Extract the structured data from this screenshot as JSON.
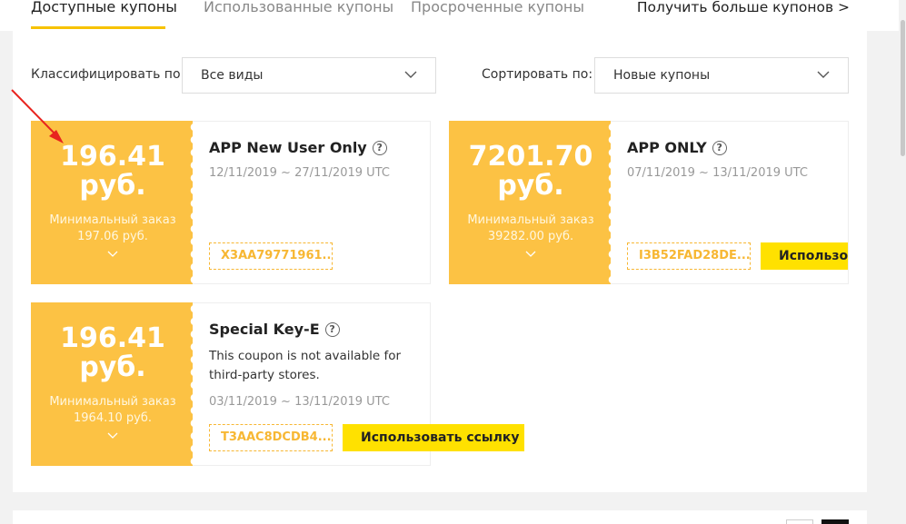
{
  "tabs": {
    "items": [
      {
        "label": "Доступные купоны",
        "active": true
      },
      {
        "label": "Использованные купоны",
        "active": false
      },
      {
        "label": "Просроченные купоны",
        "active": false
      }
    ],
    "more_link": "Получить больше купонов >"
  },
  "filters": {
    "classify_label": "Классифицировать по:",
    "classify_value": "Все виды",
    "sort_label": "Сортировать по:",
    "sort_value": "Новые купоны"
  },
  "coupons": [
    {
      "amount": "196.41 руб.",
      "min_order": "Минимальный заказ 197.06  руб.",
      "title": "APP New User Only",
      "date": "12/11/2019 ~ 27/11/2019 UTC",
      "code": "X3AA79771961..."
    },
    {
      "amount": "7201.70 руб.",
      "min_order": "Минимальный заказ 39282.00  руб.",
      "title": "APP ONLY",
      "date": "07/11/2019 ~ 13/11/2019 UTC",
      "code": "I3B52FAD28DE...",
      "use_button": "Использовать ссылку"
    },
    {
      "amount": "196.41 руб.",
      "min_order": "Минимальный заказ 1964.10  руб.",
      "title": "Special Key-E",
      "description": "This coupon is not available for third-party stores.",
      "date": "03/11/2019 ~ 13/11/2019 UTC",
      "code": "T3AAC8DCDB4...",
      "use_button": "Использовать ссылку"
    }
  ],
  "help_glyph": "?",
  "colors": {
    "accent_yellow": "#f7c200",
    "coupon_bg": "#fcc244",
    "button_yellow": "#ffe100",
    "annotation_arrow": "#e8231e"
  }
}
